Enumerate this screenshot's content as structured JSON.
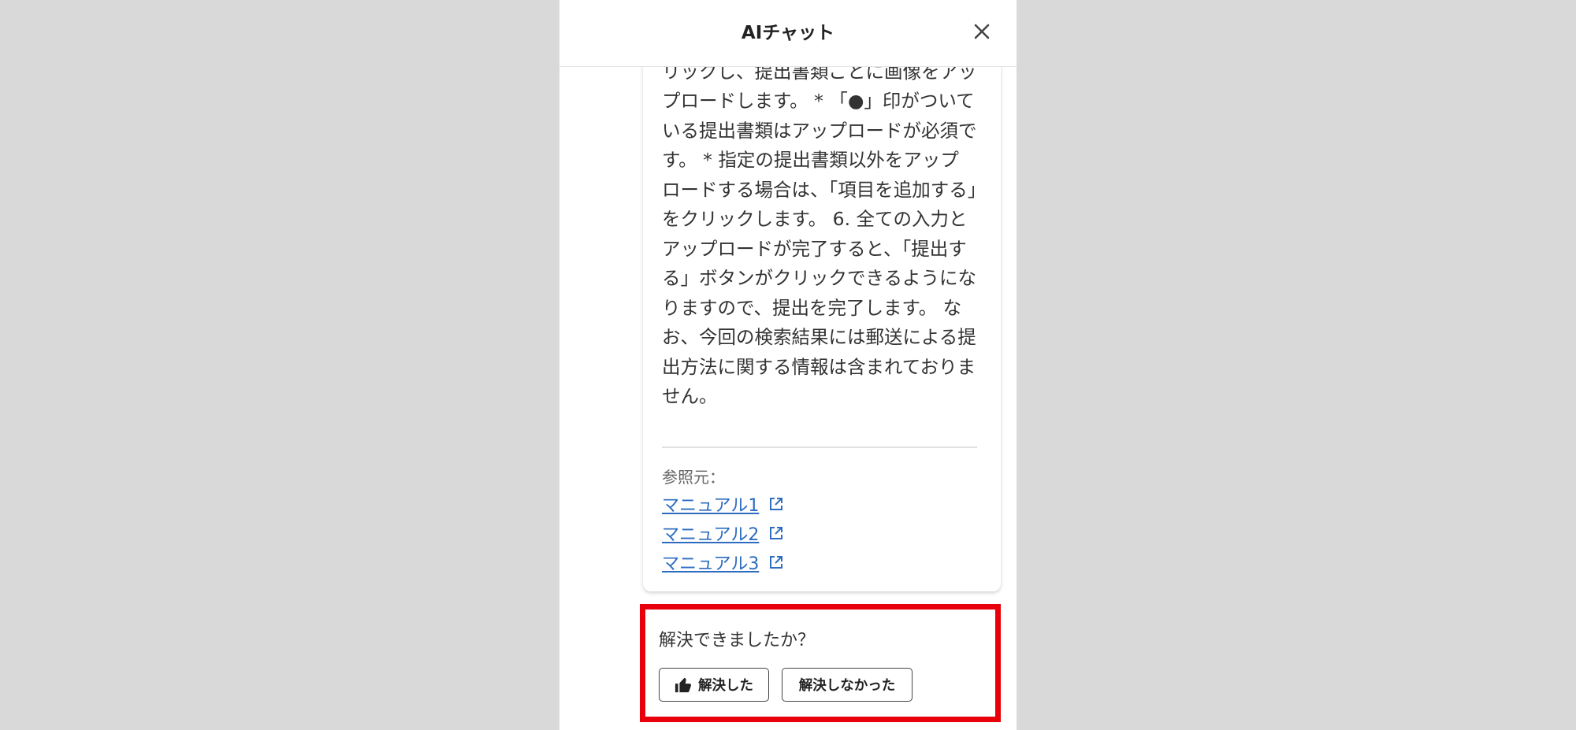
{
  "header": {
    "title": "AIチャット",
    "close_icon": "close-icon"
  },
  "answer": {
    "text": "す。 「提出書類アップロード」をクリックし、提出書類ごとに画像をアップロードします。 * 「●」印がついている提出書類はアップロードが必須です。 * 指定の提出書類以外をアップロードする場合は、「項目を追加する」をクリックします。 6. 全ての入力とアップロードが完了すると、「提出する」ボタンがクリックできるようになりますので、提出を完了します。 なお、今回の検索結果には郵送による提出方法に関する情報は含まれておりません。"
  },
  "references": {
    "label": "参照元：",
    "links": [
      {
        "label": "マニュアル1",
        "icon": "external-link-icon"
      },
      {
        "label": "マニュアル2",
        "icon": "external-link-icon"
      },
      {
        "label": "マニュアル3",
        "icon": "external-link-icon"
      }
    ]
  },
  "feedback": {
    "question": "解決できましたか？",
    "resolved_label": "解決した",
    "resolved_icon": "thumbs-up-icon",
    "unresolved_label": "解決しなかった"
  },
  "colors": {
    "highlight": "#e8000b",
    "link": "#2d6cc0",
    "backdrop": "#d9d9d9"
  }
}
